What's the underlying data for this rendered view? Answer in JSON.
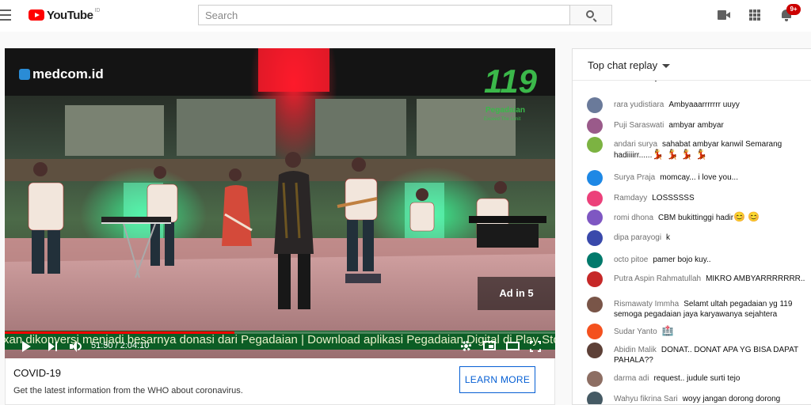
{
  "masthead": {
    "logo_text": "YouTube",
    "logo_sup": "ID",
    "search_placeholder": "Search",
    "notification_count": "9+",
    "icons": [
      "menu-icon",
      "youtube-logo",
      "search-icon",
      "create-video-icon",
      "apps-icon",
      "bell-icon"
    ]
  },
  "player": {
    "channel_logo": "medcom.id",
    "brand_badge": {
      "num": "119",
      "name": "Pegadaian",
      "tag": "Exceed The Limit"
    },
    "ad_indicator": "Ad in 5",
    "ticker": "xan dikonversi menjadi besarnya donasi dari Pegadaian | Download aplikasi Pegadaian Digital di Play Sto",
    "time": "51:50 / 2:04:10",
    "progress": 0.417,
    "colors": {
      "progress": "#ff0000",
      "ticker_bg": "#0c5d25"
    }
  },
  "ad_card": {
    "title": "COVID-19",
    "description": "Get the latest information from the WHO about coronavirus.",
    "button_label": "LEARN MORE",
    "accent": "#065fd4"
  },
  "chat": {
    "title": "Top chat replay",
    "messages": [
      {
        "author": "",
        "text": "maen biola yo",
        "avatar_color": "#8a6a50"
      },
      {
        "author": "rara yudistiara",
        "text": "Ambyaaarrrrrrr uuyy",
        "avatar_color": "#6a7a9a"
      },
      {
        "author": "Puji Saraswati",
        "text": "ambyar ambyar",
        "avatar_color": "#9a5a8a"
      },
      {
        "author": "andari surya",
        "text": "sahabat ambyar kanwil Semarang hadiiiirr......",
        "emoji": "💃 💃 💃 💃",
        "avatar_color": "#7cb342"
      },
      {
        "author": "Surya Praja",
        "text": "momcay... i love you...",
        "avatar_color": "#1e88e5"
      },
      {
        "author": "Ramdayy",
        "text": "LOSSSSSS",
        "avatar_color": "#ec407a"
      },
      {
        "author": "romi dhona",
        "text": "CBM bukittinggi hadir",
        "emoji": "😊 😊",
        "avatar_color": "#7e57c2"
      },
      {
        "author": "dipa parayogi",
        "text": "k",
        "avatar_color": "#3949ab"
      },
      {
        "author": "octo pitoe",
        "text": "pamer bojo kuy..",
        "avatar_color": "#00796b"
      },
      {
        "author": "Putra Aspin Rahmatullah",
        "text": "MIKRO AMBYARRRRRRR..",
        "avatar_color": "#c62828"
      },
      {
        "author": "Rismawaty Immha",
        "text": "Selamt ultah pegadaian yg 119 semoga pegadaian jaya karyawanya sejahtera",
        "avatar_color": "#795548"
      },
      {
        "author": "Sudar Yanto",
        "text": "",
        "emoji": "🏥",
        "avatar_color": "#f4511e"
      },
      {
        "author": "Abidin Malik",
        "text": "DONAT.. DONAT APA YG BISA DAPAT PAHALA??",
        "avatar_color": "#5d4037"
      },
      {
        "author": "darma adi",
        "text": "request.. judule surti tejo",
        "avatar_color": "#8d6e63"
      },
      {
        "author": "Wahyu fikrina Sari",
        "text": "woyy jangan dorong dorong",
        "avatar_color": "#455a64"
      }
    ]
  }
}
